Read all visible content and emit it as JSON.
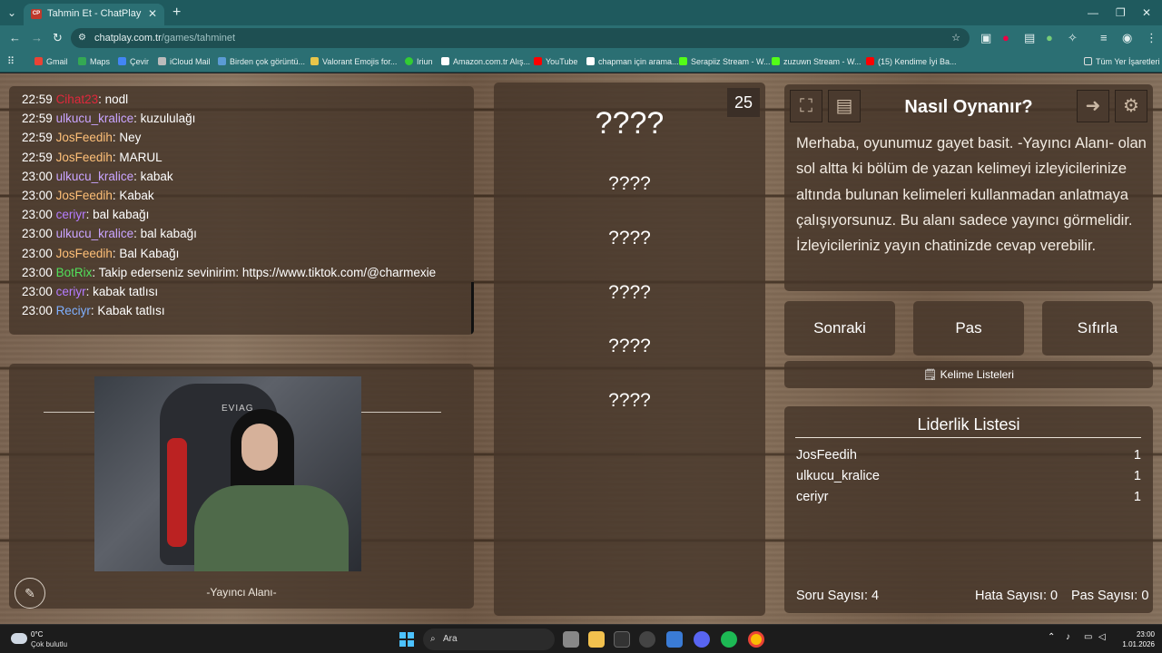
{
  "browser": {
    "tab_title": "Tahmin Et - ChatPlay",
    "tab_favicon": "CP",
    "url_domain": "chatplay.com.tr",
    "url_path": "/games/tahminet",
    "bookmarks": [
      "Gmail",
      "Maps",
      "Çevir",
      "iCloud Mail",
      "Birden çok görüntü...",
      "Valorant Emojis for...",
      "Iriun",
      "Amazon.com.tr Alış...",
      "YouTube",
      "chapman için arama...",
      "Serapiiz Stream - W...",
      "zuzuwn Stream - W...",
      "(15) Kendime İyi Ba..."
    ],
    "all_bookmarks": "Tüm Yer İşaretleri"
  },
  "chat": {
    "messages": [
      {
        "time": "22:59",
        "user": "Cihat23",
        "text": ": nodl",
        "color": "#e0283c"
      },
      {
        "time": "22:59",
        "user": "ulkucu_kralice",
        "text": ": kuzululağı",
        "color": "#c9a4ff"
      },
      {
        "time": "22:59",
        "user": "JosFeedih",
        "text": ": Ney",
        "color": "#ffc078"
      },
      {
        "time": "22:59",
        "user": "JosFeedih",
        "text": ": MARUL",
        "color": "#ffc078"
      },
      {
        "time": "23:00",
        "user": "ulkucu_kralice",
        "text": ": kabak",
        "color": "#c9a4ff"
      },
      {
        "time": "23:00",
        "user": "JosFeedih",
        "text": ": Kabak",
        "color": "#ffc078"
      },
      {
        "time": "23:00",
        "user": "ceriyr",
        "text": ": bal kabağı",
        "color": "#b57cff"
      },
      {
        "time": "23:00",
        "user": "ulkucu_kralice",
        "text": ": bal kabağı",
        "color": "#c9a4ff"
      },
      {
        "time": "23:00",
        "user": "JosFeedih",
        "text": ": Bal Kabağı",
        "color": "#ffc078"
      },
      {
        "time": "23:00",
        "user": "BotRix",
        "text": ": Takip ederseniz sevinirim: https://www.tiktok.com/@charmexie",
        "color": "#52e05a"
      },
      {
        "time": "23:00",
        "user": "ceriyr",
        "text": ": kabak tatlısı",
        "color": "#b57cff"
      },
      {
        "time": "23:00",
        "user": "Reciyr",
        "text": ": Kabak tatlısı",
        "color": "#7fb0ff"
      }
    ]
  },
  "streamer": {
    "label": "-Yayıncı Alanı-",
    "cam_brand": "EVIAG"
  },
  "words": {
    "counter": "25",
    "main": "????",
    "list": [
      "????",
      "????",
      "????",
      "????",
      "????"
    ]
  },
  "howto": {
    "title": "Nasıl Oynanır?",
    "text": "Merhaba, oyunumuz gayet basit. -Yayıncı Alanı- olan sol altta ki bölüm de yazan kelimeyi izleyicilerinize altında bulunan kelimeleri kullanmadan anlatmaya çalışıyorsunuz. Bu alanı sadece yayıncı görmelidir. İzleyicileriniz yayın chatinizde cevap verebilir."
  },
  "buttons": {
    "next": "Sonraki",
    "pass": "Pas",
    "reset": "Sıfırla",
    "word_lists": "Kelime Listeleri"
  },
  "leaderboard": {
    "title": "Liderlik Listesi",
    "rows": [
      {
        "name": "JosFeedih",
        "score": "1"
      },
      {
        "name": "ulkucu_kralice",
        "score": "1"
      },
      {
        "name": "ceriyr",
        "score": "1"
      }
    ],
    "question_count": "Soru Sayısı: 4",
    "error_count": "Hata Sayısı: 0",
    "pass_count": "Pas Sayısı: 0"
  },
  "taskbar": {
    "weather_temp": "0°C",
    "weather_desc": "Çok bulutlu",
    "search_placeholder": "Ara",
    "time": "23:00",
    "date": "1.01.2026"
  }
}
